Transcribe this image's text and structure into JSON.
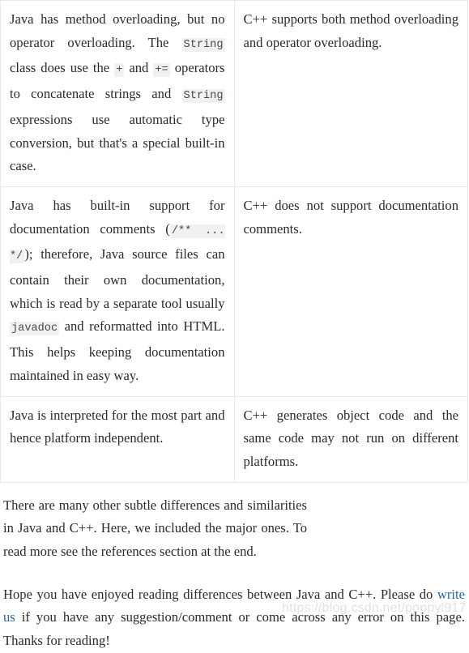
{
  "table": {
    "rows": [
      {
        "left": {
          "segments": [
            {
              "type": "text",
              "value": "Java has method overloading, but no operator overloading. The "
            },
            {
              "type": "code",
              "value": "String"
            },
            {
              "type": "text",
              "value": " class does use the "
            },
            {
              "type": "code",
              "value": "+"
            },
            {
              "type": "text",
              "value": " and "
            },
            {
              "type": "code",
              "value": "+="
            },
            {
              "type": "text",
              "value": " operators to concatenate strings and "
            },
            {
              "type": "code",
              "value": "String"
            },
            {
              "type": "text",
              "value": " expressions use automatic type conversion, but that's a special built-in case."
            }
          ]
        },
        "right": {
          "segments": [
            {
              "type": "text",
              "value": "C++ supports both method overloading and operator overloading."
            }
          ]
        }
      },
      {
        "left": {
          "segments": [
            {
              "type": "text",
              "value": "Java has built-in support for documentation comments ("
            },
            {
              "type": "code",
              "value": "/** ... */"
            },
            {
              "type": "text",
              "value": "); therefore, Java source files can contain their own documentation, which is read by a separate tool usually "
            },
            {
              "type": "code",
              "value": "javadoc"
            },
            {
              "type": "text",
              "value": " and reformatted into HTML. This helps keeping documentation maintained in easy way."
            }
          ]
        },
        "right": {
          "segments": [
            {
              "type": "text",
              "value": "C++ does not support documentation comments."
            }
          ]
        }
      },
      {
        "left": {
          "segments": [
            {
              "type": "text",
              "value": "Java is interpreted for the most part and hence platform independent."
            }
          ]
        },
        "right": {
          "segments": [
            {
              "type": "text",
              "value": "C++ generates object code and the same code may not run on different platforms."
            }
          ]
        }
      }
    ]
  },
  "paragraphs": [
    {
      "id": "summary",
      "segments": [
        {
          "type": "text",
          "value": "There are many other subtle differences and similarities in Java and C++. Here, we included the major ones. To read more see the references section at the end."
        }
      ]
    },
    {
      "id": "closing",
      "segments": [
        {
          "type": "text",
          "value": "Hope you have enjoyed reading differences between Java and C++. Please do "
        },
        {
          "type": "link",
          "value": "write us"
        },
        {
          "type": "text",
          "value": " if you have any suggestion/comment or come across any error on this page. Thanks for reading!"
        }
      ]
    }
  ],
  "watermark": {
    "text": "https://blog.csdn.net/poppyl917"
  },
  "colors": {
    "text": "#2b2b2b",
    "link": "#2767ad",
    "table_border": "#e3eaf0",
    "code_background": "#eff1f3",
    "code_text": "#4a4a4a",
    "watermark": "#e2e2e2",
    "page_background": "#ffffff"
  }
}
